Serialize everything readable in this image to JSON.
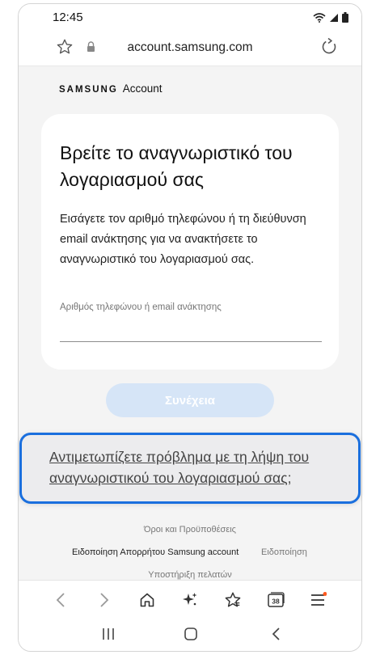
{
  "status": {
    "time": "12:45"
  },
  "browser": {
    "url": "account.samsung.com"
  },
  "brand": {
    "samsung": "SAMSUNG",
    "account": "Account"
  },
  "card": {
    "title": "Βρείτε το αναγνωριστικό του λογαριασμού σας",
    "description": "Εισάγετε τον αριθμό τηλεφώνου ή τη διεύθυνση email ανάκτησης για να ανακτήσετε το αναγνωριστικό του λογαριασμού σας.",
    "input_placeholder": "Αριθμός τηλεφώνου ή email ανάκτησης",
    "input_value": ""
  },
  "continue_label": "Συνέχεια",
  "help_link": "Αντιμετωπίζετε πρόβλημα με τη λήψη του αναγνωριστικού του λογαριασμού σας;",
  "footer": {
    "terms": "Όροι και Προϋποθέσεις",
    "privacy": "Ειδοποίηση Απορρήτου Samsung account",
    "notice": "Ειδοποίηση",
    "support": "Υποστήριξη πελατών"
  },
  "tabs_count": "38",
  "colors": {
    "accent": "#1a6fde",
    "button_disabled": "#d6e5f7",
    "page_bg": "#f4f4f4"
  }
}
